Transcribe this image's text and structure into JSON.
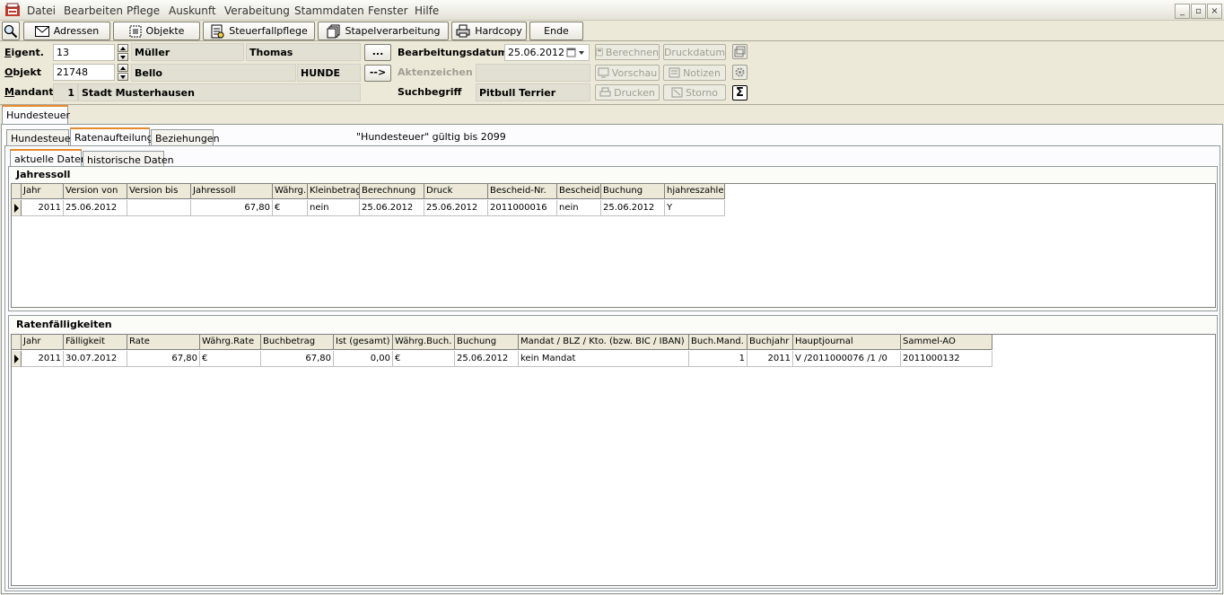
{
  "menu": [
    "Datei",
    "Bearbeiten",
    "Pflege",
    "Auskunft",
    "Verabeitung",
    "Stammdaten",
    "Fenster",
    "Hilfe"
  ],
  "window_buttons": [
    "_",
    "▫",
    "×"
  ],
  "toolbar": {
    "adressen": "Adressen",
    "objekte": "Objekte",
    "steuerfallpflege": "Steuerfallpflege",
    "stapelverarbeitung": "Stapelverarbeitung",
    "hardcopy": "Hardcopy",
    "ende": "Ende"
  },
  "header": {
    "eigent_label": "Eigent.",
    "eigent_value": "13",
    "eigent_name": "Müller",
    "eigent_vorname": "Thomas",
    "objekt_label": "Objekt",
    "objekt_value": "21748",
    "objekt_name": "Bello",
    "objekt_art": "HUNDE",
    "mandant_label": "Mandant",
    "mandant_value": "1",
    "mandant_name": "Stadt Musterhausen",
    "btn_dots": "...",
    "btn_arrow": "-->",
    "bearbeitungsdatum_label": "Bearbeitungsdatum",
    "bearbeitungsdatum_value": "25.06.2012",
    "aktenzeichen_label": "Aktenzeichen",
    "aktenzeichen_value": "",
    "suchbegriff_label": "Suchbegriff",
    "suchbegriff_value": "Pitbull Terrier",
    "berechnen": "Berechnen",
    "druckdatum": "Druckdatum",
    "vorschau": "Vorschau",
    "notizen": "Notizen",
    "drucken": "Drucken",
    "storno": "Storno",
    "sigma": "Σ"
  },
  "main_tab": "Hundesteuer",
  "sub_tabs": [
    "Hundesteuer",
    "Ratenaufteilung",
    "Beziehungen"
  ],
  "validity": "\"Hundesteuer\" gültig bis 2099",
  "inner_tabs": [
    "aktuelle Daten",
    "historische Daten"
  ],
  "jahressoll": {
    "title": "Jahressoll",
    "columns": [
      "Jahr",
      "Version von",
      "Version bis",
      "Jahressoll",
      "Währg.",
      "Kleinbetrag",
      "Berechnung",
      "Druck",
      "Bescheid-Nr.",
      "Bescheid",
      "Buchung",
      "hjahreszahler"
    ],
    "rows": [
      [
        "2011",
        "25.06.2012",
        "",
        "67,80",
        "€",
        "nein",
        "25.06.2012",
        "25.06.2012",
        "2011000016",
        "nein",
        "25.06.2012",
        "Y"
      ]
    ]
  },
  "raten": {
    "title": "Ratenfälligkeiten",
    "columns": [
      "Jahr",
      "Fälligkeit",
      "Rate",
      "Währg.Rate",
      "Buchbetrag",
      "Ist (gesamt)",
      "Währg.Buch.",
      "Buchung",
      "Mandat / BLZ / Kto. (bzw. BIC / IBAN)",
      "Buch.Mand.",
      "Buchjahr",
      "Hauptjournal",
      "Sammel-AO"
    ],
    "rows": [
      [
        "2011",
        "30.07.2012",
        "67,80",
        "€",
        "67,80",
        "0,00",
        "€",
        "25.06.2012",
        "kein Mandat",
        "1",
        "2011",
        "V /2011000076 /1 /0",
        "2011000132"
      ]
    ]
  }
}
